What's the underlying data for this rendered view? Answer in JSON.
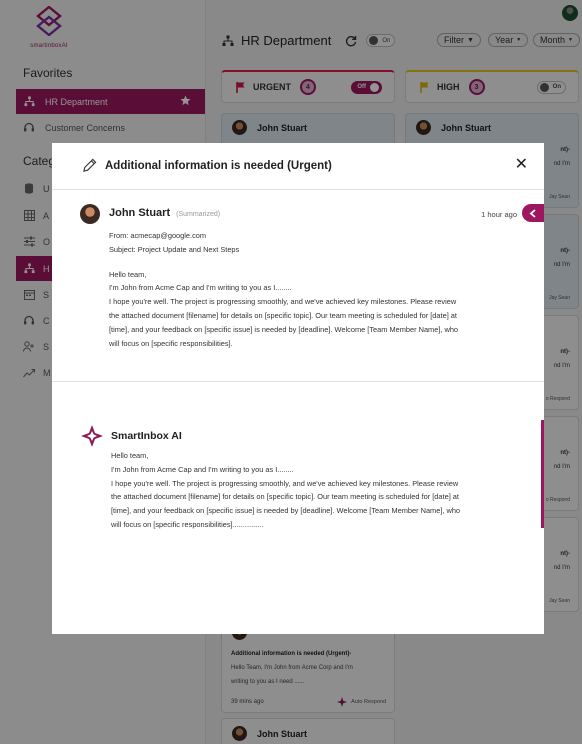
{
  "app": {
    "logo_text": "smartinboxAI"
  },
  "sidebar": {
    "favorites_title": "Favorites",
    "favorites": [
      {
        "label": "HR Department",
        "icon": "org-icon",
        "active": true
      },
      {
        "label": "Customer Concerns",
        "icon": "headset-icon",
        "active": false
      }
    ],
    "categories_title": "Categ",
    "categories": [
      {
        "label": "U",
        "icon": "database-icon"
      },
      {
        "label": "A",
        "icon": "table-icon"
      },
      {
        "label": "O",
        "icon": "sliders-icon"
      },
      {
        "label": "H",
        "icon": "org-icon",
        "active": true
      },
      {
        "label": "S",
        "icon": "calendar-icon"
      },
      {
        "label": "C",
        "icon": "headset-icon"
      },
      {
        "label": "S",
        "icon": "users-icon"
      },
      {
        "label": "M",
        "icon": "trend-icon"
      }
    ]
  },
  "header": {
    "title": "HR Department",
    "toggle_label": "On",
    "filter_label": "Filter",
    "year_label": "Year",
    "month_label": "Month"
  },
  "columns": [
    {
      "label": "URGENT",
      "count": "4",
      "toggle": "Off",
      "accent": "#e01b4c"
    },
    {
      "label": "HIGH",
      "count": "3",
      "toggle": "On",
      "accent": "#e5c31a"
    }
  ],
  "background_cards": {
    "sender": "John Stuart",
    "bottom_card": {
      "title": "Additional information is needed (Urgent)-",
      "preview_1": "Hello Team, I'm John from Acme Corp and I'm",
      "preview_2": "writing to you as I need ......",
      "time": "39 mins ago",
      "action": "Auto Respond"
    },
    "last_sender": "John Stuart",
    "right_snippets": [
      "nt)-",
      "nd I'm",
      "Jay Sean",
      "nt)-",
      "nd I'm",
      "Jay Sean",
      "nt)-",
      "nd I'm",
      "o Respond",
      "nt)-",
      "nd I'm",
      "o Respond",
      "nt)-",
      "nd I'm",
      "Jay Sean"
    ]
  },
  "modal": {
    "title": "Additional information is needed (Urgent)",
    "message": {
      "sender": "John Stuart",
      "tag": "(Summarized)",
      "time": "1 hour ago",
      "from": "From: acmecap@google.com",
      "subject": "Subject: Project Update and Next Steps",
      "greeting": "Hello team,",
      "line1": "I'm John from Acme Cap and I'm writing to you as I........",
      "line2": "I hope you're well. The project is progressing smoothly, and we've achieved key milestones. Please review",
      "line3": "the attached document [filename] for details on [specific topic]. Our team meeting is scheduled for [date] at",
      "line4": "[time], and your feedback on [specific issue] is needed by [deadline]. Welcome [Team Member Name], who",
      "line5": "will focus on [specific responsibilities]."
    },
    "ai": {
      "title": "SmartInbox AI",
      "greeting": "Hello team,",
      "line1": "I'm John from Acme Cap and I'm writing to you as I........",
      "line2": "I hope you're well. The project is progressing smoothly, and we've achieved key milestones. Please review",
      "line3": "the attached document [filename] for details on [specific topic]. Our team meeting is scheduled for [date] at",
      "line4": "[time], and your feedback on [specific issue] is needed by [deadline]. Welcome [Team Member Name], who",
      "line5": "will focus on [specific responsibilities]..............."
    }
  },
  "colors": {
    "brand": "#9c1760",
    "urgent": "#e01b4c",
    "high": "#e5c31a"
  }
}
